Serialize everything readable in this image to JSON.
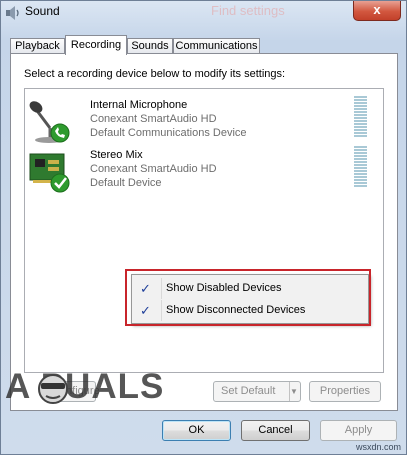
{
  "window": {
    "title": "Sound",
    "ghost_text": "Find settings",
    "close_glyph": "x"
  },
  "tabs": [
    {
      "label": "Playback",
      "active": false
    },
    {
      "label": "Recording",
      "active": true
    },
    {
      "label": "Sounds",
      "active": false
    },
    {
      "label": "Communications",
      "active": false
    }
  ],
  "panel": {
    "instruction": "Select a recording device below to modify its settings:",
    "devices": [
      {
        "name": "Internal Microphone",
        "driver": "Conexant SmartAudio HD",
        "status": "Default Communications Device",
        "icon": "microphone-icon",
        "badge": "green-phone-badge-icon"
      },
      {
        "name": "Stereo Mix",
        "driver": "Conexant SmartAudio HD",
        "status": "Default Device",
        "icon": "sound-card-icon",
        "badge": "green-check-badge-icon"
      }
    ]
  },
  "context_menu": {
    "items": [
      {
        "label": "Show Disabled Devices",
        "checked": true
      },
      {
        "label": "Show Disconnected Devices",
        "checked": true
      }
    ],
    "check_glyph": "✓"
  },
  "buttons": {
    "configure": "Configure",
    "set_default": "Set Default",
    "properties": "Properties",
    "ok": "OK",
    "cancel": "Cancel",
    "apply": "Apply"
  },
  "watermark": {
    "text": "A  PUALS",
    "site": "wsxdn.com"
  },
  "colors": {
    "highlight_box": "#c8252b",
    "check": "#1f3f9a",
    "badge_green": "#2e9b2e"
  }
}
